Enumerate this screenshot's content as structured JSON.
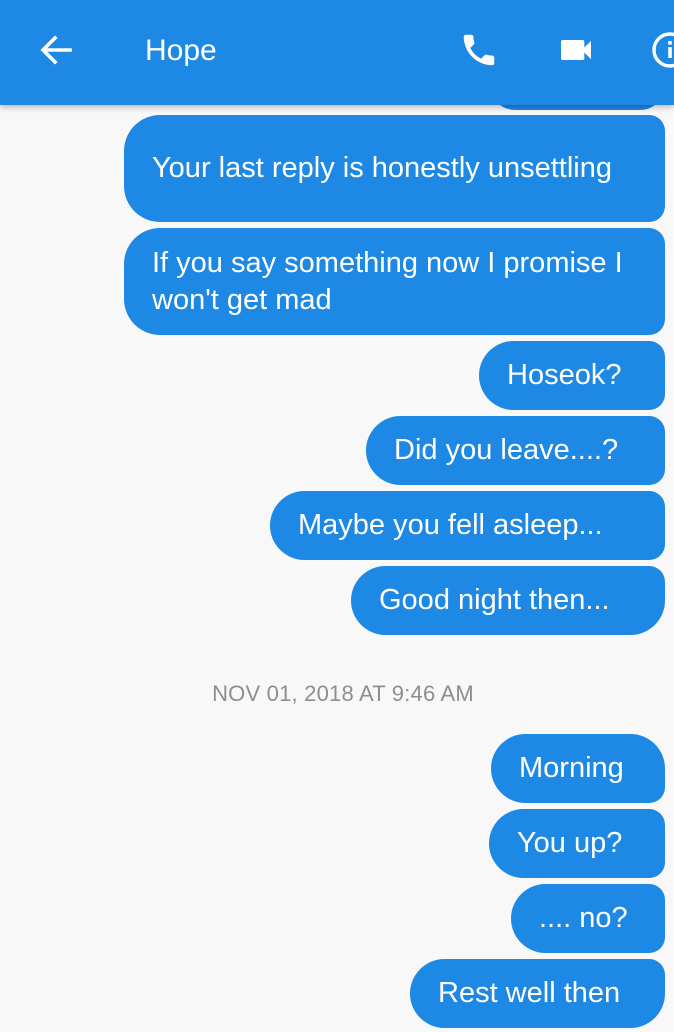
{
  "header": {
    "contact_name": "Hope",
    "back_icon": "arrow-left-icon",
    "call_icon": "phone-icon",
    "video_icon": "video-camera-icon",
    "info_icon": "info-icon",
    "bar_color": "#1e88e5"
  },
  "messages_before": [
    {
      "text": "Your last reply is honestly unsettling"
    },
    {
      "text": "If you say something now I promise I won't get mad"
    },
    {
      "text": "Hoseok?"
    },
    {
      "text": "Did you leave....?"
    },
    {
      "text": "Maybe you fell asleep..."
    },
    {
      "text": "Good night then..."
    }
  ],
  "timestamp": "NOV 01, 2018 AT 9:46 AM",
  "messages_after": [
    {
      "text": "Morning"
    },
    {
      "text": "You up?"
    },
    {
      "text": ".... no?"
    },
    {
      "text": "Rest well then"
    }
  ],
  "colors": {
    "bubble": "#1e88e5",
    "bubble_text": "#ffffff",
    "background": "#f8f8f8",
    "timestamp": "#8e8e8e"
  }
}
